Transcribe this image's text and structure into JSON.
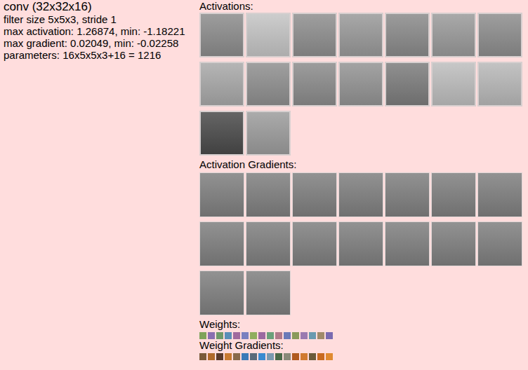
{
  "layer": {
    "title": "conv (32x32x16)",
    "details": [
      "filter size 5x5x3, stride 1",
      "max activation: 1.26874, min: -1.18221",
      "max gradient: 0.02049, min: -0.02258",
      "parameters: 16x5x5x3+16 = 1216"
    ]
  },
  "activations": {
    "label": "Activations:",
    "maps": [
      {
        "color": "#8c8c8c"
      },
      {
        "color": "#c4c4c4"
      },
      {
        "color": "#8e8e8e"
      },
      {
        "color": "#999999"
      },
      {
        "color": "#8a8a8a"
      },
      {
        "color": "#9a9a9a"
      },
      {
        "color": "#8d8d8d"
      },
      {
        "color": "#a8a8a8"
      },
      {
        "color": "#8f8f8f"
      },
      {
        "color": "#8b8b8b"
      },
      {
        "color": "#939393"
      },
      {
        "color": "#7c7c7c"
      },
      {
        "color": "#bdbdbd"
      },
      {
        "color": "#b8b8b8"
      },
      {
        "color": "#4a4a4a"
      },
      {
        "color": "#9c9c9c"
      }
    ]
  },
  "activation_gradients": {
    "label": "Activation Gradients:",
    "maps": [
      {
        "color": "#7f7f7f"
      },
      {
        "color": "#7f7f7f"
      },
      {
        "color": "#7f7f7f"
      },
      {
        "color": "#7f7f7f"
      },
      {
        "color": "#7f7f7f"
      },
      {
        "color": "#7f7f7f"
      },
      {
        "color": "#7f7f7f"
      },
      {
        "color": "#7f7f7f"
      },
      {
        "color": "#7f7f7f"
      },
      {
        "color": "#7f7f7f"
      },
      {
        "color": "#7f7f7f"
      },
      {
        "color": "#7f7f7f"
      },
      {
        "color": "#7f7f7f"
      },
      {
        "color": "#7f7f7f"
      },
      {
        "color": "#7f7f7f"
      },
      {
        "color": "#7f7f7f"
      }
    ]
  },
  "weights": {
    "label": "Weights:",
    "tiles": [
      {
        "color": "#7fa35a"
      },
      {
        "color": "#8a6fb0"
      },
      {
        "color": "#6f9a6a"
      },
      {
        "color": "#5a8fb8"
      },
      {
        "color": "#a06a9e"
      },
      {
        "color": "#7a80c0"
      },
      {
        "color": "#8fae5e"
      },
      {
        "color": "#9a6aa0"
      },
      {
        "color": "#6aa07a"
      },
      {
        "color": "#b07a8a"
      },
      {
        "color": "#6a7ab8"
      },
      {
        "color": "#8a9a5a"
      },
      {
        "color": "#9a7ab0"
      },
      {
        "color": "#6a9ab0"
      },
      {
        "color": "#a08a6a"
      },
      {
        "color": "#7a6ab0"
      }
    ]
  },
  "weight_gradients": {
    "label": "Weight Gradients:",
    "tiles": [
      {
        "color": "#7a5a3a"
      },
      {
        "color": "#b06a2a"
      },
      {
        "color": "#5a3a2a"
      },
      {
        "color": "#c87a30"
      },
      {
        "color": "#8a6a4a"
      },
      {
        "color": "#3a7ab8"
      },
      {
        "color": "#5a6a7a"
      },
      {
        "color": "#3a8ad0"
      },
      {
        "color": "#7a9ab0"
      },
      {
        "color": "#4a6a4a"
      },
      {
        "color": "#8a8a7a"
      },
      {
        "color": "#b05a20"
      },
      {
        "color": "#d07a30"
      },
      {
        "color": "#6a5a3a"
      },
      {
        "color": "#c86a20"
      },
      {
        "color": "#e08a30"
      }
    ]
  }
}
